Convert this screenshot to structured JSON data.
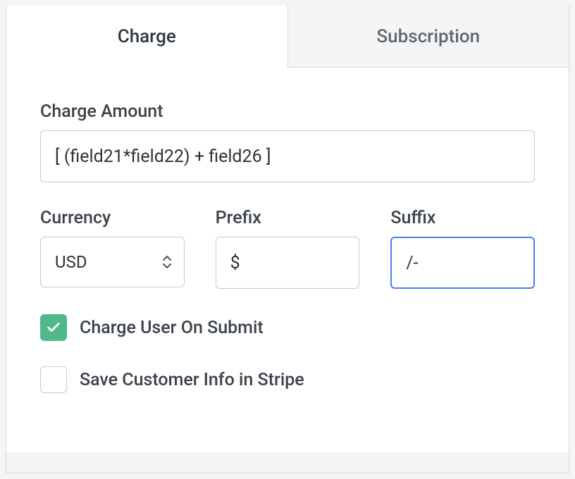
{
  "tabs": {
    "charge": "Charge",
    "subscription": "Subscription"
  },
  "form": {
    "charge_amount": {
      "label": "Charge Amount",
      "value": "[ (field21*field22) + field26 ]"
    },
    "currency": {
      "label": "Currency",
      "value": "USD"
    },
    "prefix": {
      "label": "Prefix",
      "value": "$"
    },
    "suffix": {
      "label": "Suffix",
      "value": "/-"
    },
    "charge_on_submit": {
      "label": "Charge User On Submit",
      "checked": true
    },
    "save_customer": {
      "label": "Save Customer Info in Stripe",
      "checked": false
    }
  }
}
